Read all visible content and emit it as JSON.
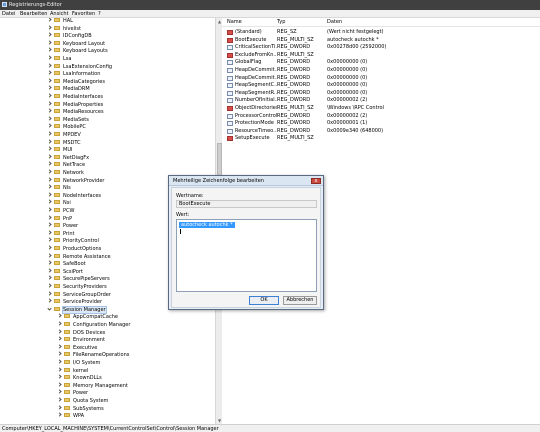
{
  "window": {
    "title": "Registrierungs-Editor"
  },
  "menu": [
    "Datei",
    "Bearbeiten",
    "Ansicht",
    "Favoriten",
    "?"
  ],
  "tree": {
    "items": [
      {
        "label": "HAL",
        "depth": 0,
        "expanded": false
      },
      {
        "label": "hivelist",
        "depth": 0,
        "expanded": false
      },
      {
        "label": "IDConfigDB",
        "depth": 0,
        "expanded": false
      },
      {
        "label": "Keyboard Layout",
        "depth": 0,
        "expanded": false
      },
      {
        "label": "Keyboard Layouts",
        "depth": 0,
        "expanded": false
      },
      {
        "label": "Lsa",
        "depth": 0,
        "expanded": false
      },
      {
        "label": "LsaExtensionConfig",
        "depth": 0,
        "expanded": false
      },
      {
        "label": "LsaInformation",
        "depth": 0,
        "expanded": false
      },
      {
        "label": "MediaCategories",
        "depth": 0,
        "expanded": false
      },
      {
        "label": "MediaDRM",
        "depth": 0,
        "expanded": false
      },
      {
        "label": "MediaInterfaces",
        "depth": 0,
        "expanded": false
      },
      {
        "label": "MediaProperties",
        "depth": 0,
        "expanded": false
      },
      {
        "label": "MediaResources",
        "depth": 0,
        "expanded": false
      },
      {
        "label": "MediaSets",
        "depth": 0,
        "expanded": false
      },
      {
        "label": "MobilePC",
        "depth": 0,
        "expanded": false
      },
      {
        "label": "MPDEV",
        "depth": 0,
        "expanded": false
      },
      {
        "label": "MSDTC",
        "depth": 0,
        "expanded": false
      },
      {
        "label": "MUI",
        "depth": 0,
        "expanded": false
      },
      {
        "label": "NetDiagFx",
        "depth": 0,
        "expanded": false
      },
      {
        "label": "NetTrace",
        "depth": 0,
        "expanded": false
      },
      {
        "label": "Network",
        "depth": 0,
        "expanded": false
      },
      {
        "label": "NetworkProvider",
        "depth": 0,
        "expanded": false
      },
      {
        "label": "Nls",
        "depth": 0,
        "expanded": false
      },
      {
        "label": "NodeInterfaces",
        "depth": 0,
        "expanded": false
      },
      {
        "label": "Nsi",
        "depth": 0,
        "expanded": false
      },
      {
        "label": "PCW",
        "depth": 0,
        "expanded": false
      },
      {
        "label": "PnP",
        "depth": 0,
        "expanded": false
      },
      {
        "label": "Power",
        "depth": 0,
        "expanded": false
      },
      {
        "label": "Print",
        "depth": 0,
        "expanded": false
      },
      {
        "label": "PriorityControl",
        "depth": 0,
        "expanded": false
      },
      {
        "label": "ProductOptions",
        "depth": 0,
        "expanded": false
      },
      {
        "label": "Remote Assistance",
        "depth": 0,
        "expanded": false
      },
      {
        "label": "SafeBoot",
        "depth": 0,
        "expanded": false
      },
      {
        "label": "ScsiPort",
        "depth": 0,
        "expanded": false
      },
      {
        "label": "SecurePipeServers",
        "depth": 0,
        "expanded": false
      },
      {
        "label": "SecurityProviders",
        "depth": 0,
        "expanded": false
      },
      {
        "label": "ServiceGroupOrder",
        "depth": 0,
        "expanded": false
      },
      {
        "label": "ServiceProvider",
        "depth": 0,
        "expanded": false
      },
      {
        "label": "Session Manager",
        "depth": 0,
        "expanded": true
      },
      {
        "label": "AppCompatCache",
        "depth": 1,
        "expanded": false
      },
      {
        "label": "Configuration Manager",
        "depth": 1,
        "expanded": false
      },
      {
        "label": "DOS Devices",
        "depth": 1,
        "expanded": false
      },
      {
        "label": "Environment",
        "depth": 1,
        "expanded": false
      },
      {
        "label": "Executive",
        "depth": 1,
        "expanded": false
      },
      {
        "label": "FileRenameOperations",
        "depth": 1,
        "expanded": false
      },
      {
        "label": "I/O System",
        "depth": 1,
        "expanded": false
      },
      {
        "label": "kernel",
        "depth": 1,
        "expanded": false
      },
      {
        "label": "KnownDLLs",
        "depth": 1,
        "expanded": false
      },
      {
        "label": "Memory Management",
        "depth": 1,
        "expanded": false
      },
      {
        "label": "Power",
        "depth": 1,
        "expanded": false
      },
      {
        "label": "Quota System",
        "depth": 1,
        "expanded": false
      },
      {
        "label": "SubSystems",
        "depth": 1,
        "expanded": false
      },
      {
        "label": "WPA",
        "depth": 1,
        "expanded": false
      }
    ]
  },
  "values": {
    "headers": {
      "name": "Name",
      "type": "Typ",
      "data": "Daten"
    },
    "rows": [
      {
        "name": "(Standard)",
        "type": "REG_SZ",
        "data": "(Wert nicht festgelegt)",
        "kind": "sz"
      },
      {
        "name": "BootExecute",
        "type": "REG_MULTI_SZ",
        "data": "autocheck autochk *",
        "kind": "sz"
      },
      {
        "name": "CriticalSectionTi...",
        "type": "REG_DWORD",
        "data": "0x00278d00 (2592000)",
        "kind": "bin"
      },
      {
        "name": "ExcludeFromKn...",
        "type": "REG_MULTI_SZ",
        "data": "",
        "kind": "sz"
      },
      {
        "name": "GlobalFlag",
        "type": "REG_DWORD",
        "data": "0x00000000 (0)",
        "kind": "bin"
      },
      {
        "name": "HeapDeCommit...",
        "type": "REG_DWORD",
        "data": "0x00000000 (0)",
        "kind": "bin"
      },
      {
        "name": "HeapDeCommit...",
        "type": "REG_DWORD",
        "data": "0x00000000 (0)",
        "kind": "bin"
      },
      {
        "name": "HeapSegmentC...",
        "type": "REG_DWORD",
        "data": "0x00000000 (0)",
        "kind": "bin"
      },
      {
        "name": "HeapSegmentR...",
        "type": "REG_DWORD",
        "data": "0x00000000 (0)",
        "kind": "bin"
      },
      {
        "name": "NumberOfInitial...",
        "type": "REG_DWORD",
        "data": "0x00000002 (2)",
        "kind": "bin"
      },
      {
        "name": "ObjectDirectories",
        "type": "REG_MULTI_SZ",
        "data": "\\Windows \\RPC Control",
        "kind": "sz"
      },
      {
        "name": "ProcessorControl",
        "type": "REG_DWORD",
        "data": "0x00000002 (2)",
        "kind": "bin"
      },
      {
        "name": "ProtectionMode",
        "type": "REG_DWORD",
        "data": "0x00000001 (1)",
        "kind": "bin"
      },
      {
        "name": "ResourceTimeo...",
        "type": "REG_DWORD",
        "data": "0x0009e340 (648000)",
        "kind": "bin"
      },
      {
        "name": "SetupExecute",
        "type": "REG_MULTI_SZ",
        "data": "",
        "kind": "sz"
      }
    ]
  },
  "status": {
    "path": "Computer\\HKEY_LOCAL_MACHINE\\SYSTEM\\CurrentControlSet\\Control\\Session Manager"
  },
  "dialog": {
    "title": "Mehrteilige Zeichenfolge bearbeiten",
    "close": "x",
    "name_label": "Wertname:",
    "name_value": "BootExecute",
    "data_label": "Wert:",
    "data_value": "autocheck autochk *",
    "ok_label": "OK",
    "cancel_label": "Abbrechen"
  }
}
